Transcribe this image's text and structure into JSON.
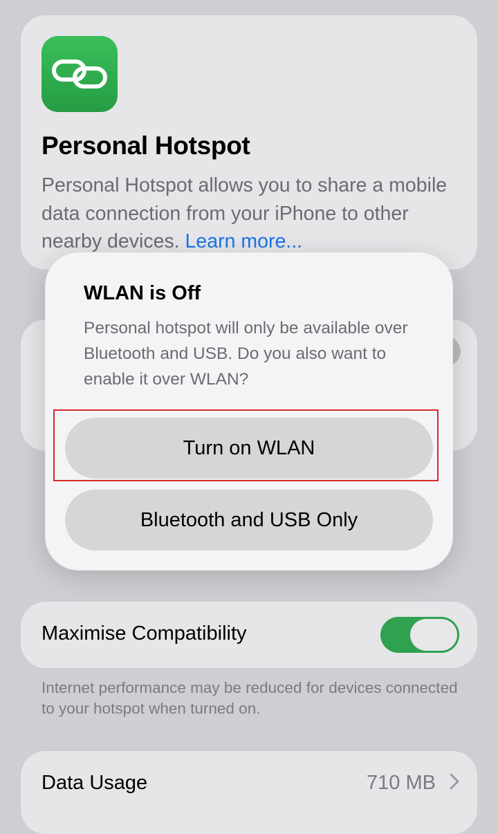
{
  "hero": {
    "title": "Personal Hotspot",
    "description": "Personal Hotspot allows you to share a mobile data connection from your iPhone to other nearby devices.",
    "learn_more": "Learn more...",
    "icon": "link-icon"
  },
  "compatibility": {
    "label": "Maximise Compatibility",
    "toggle_on": true,
    "footnote": "Internet performance may be reduced for devices connected to your hotspot when turned on."
  },
  "data_usage": {
    "label": "Data Usage",
    "value": "710 MB"
  },
  "alert": {
    "title": "WLAN is Off",
    "message": "Personal hotspot will only be available over Bluetooth and USB. Do you also want to enable it over WLAN?",
    "primary_button": "Turn on WLAN",
    "secondary_button": "Bluetooth and USB Only"
  },
  "colors": {
    "accent_green": "#30a14e",
    "link_blue": "#1a74e8",
    "highlight_red": "#d9262c"
  }
}
